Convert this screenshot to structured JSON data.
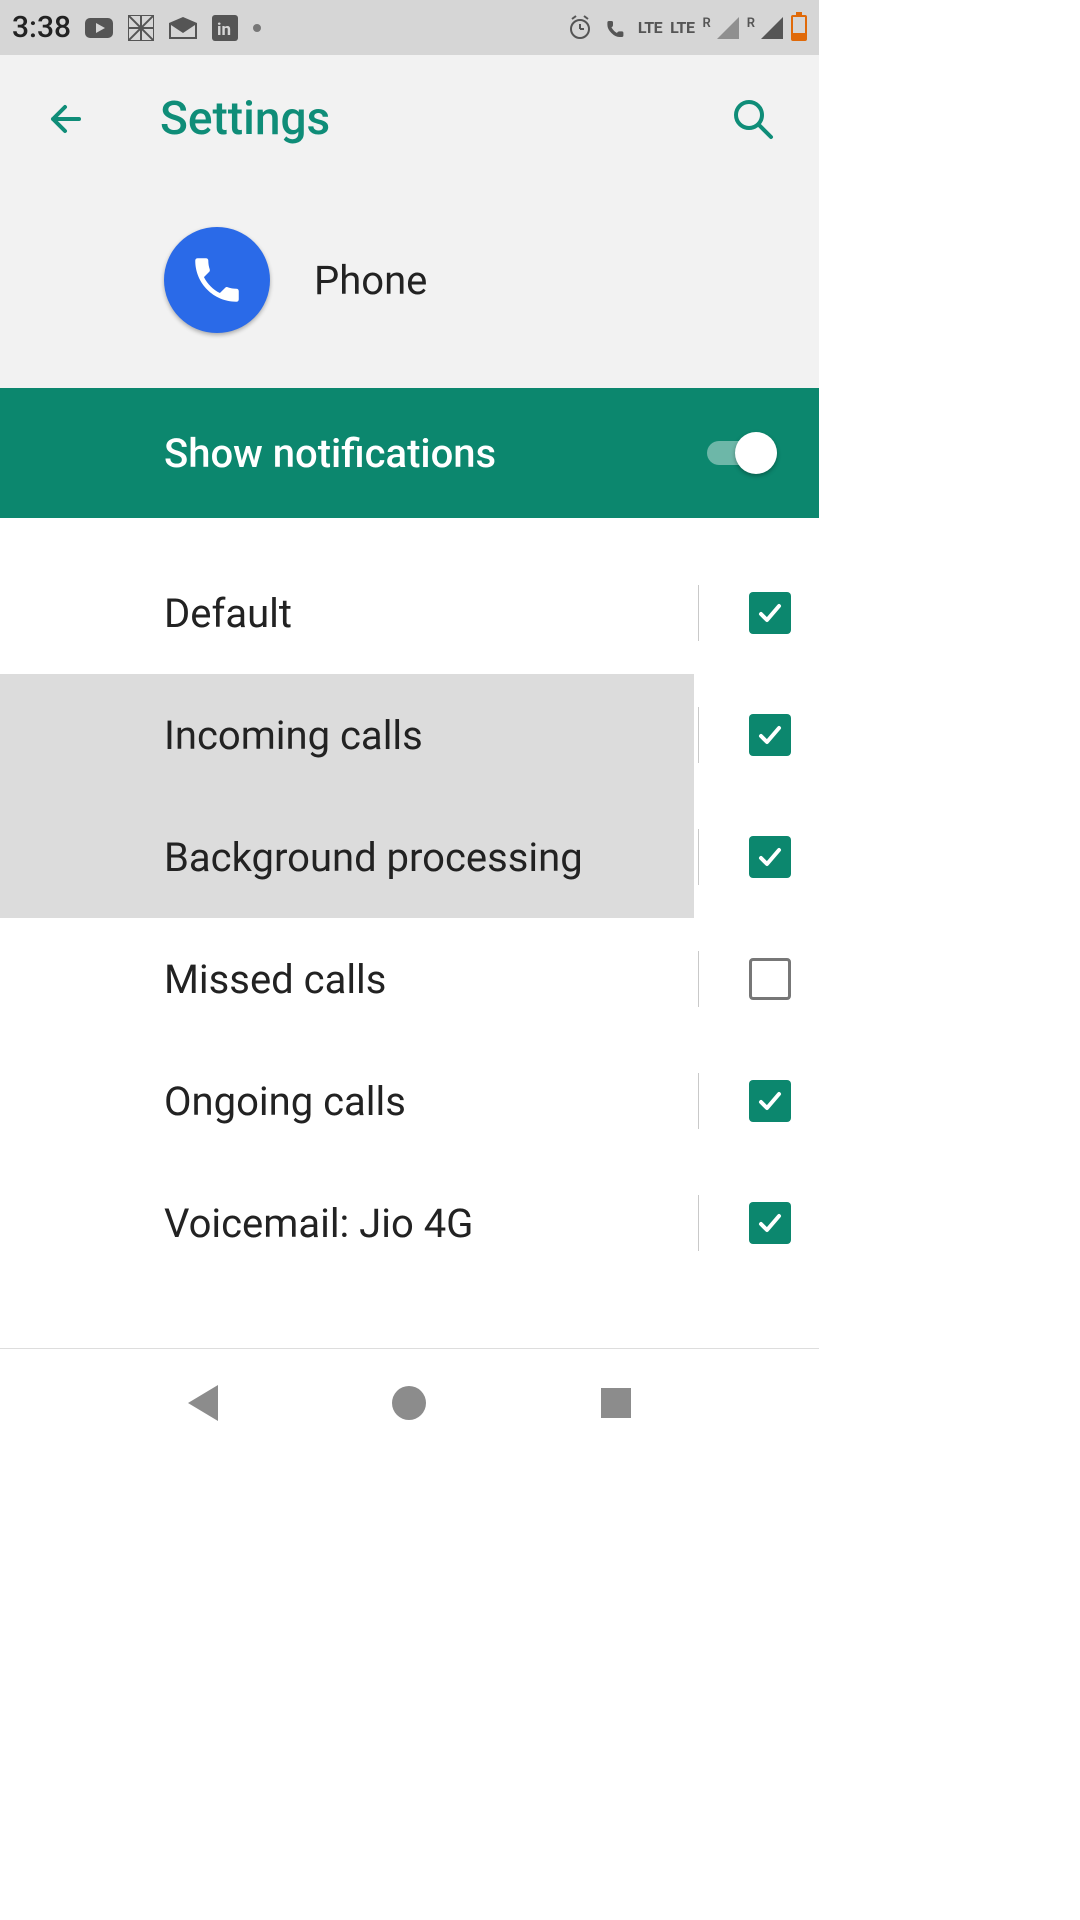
{
  "status": {
    "time": "3:38",
    "lte1": "LTE",
    "lte2": "LTE",
    "r": "R"
  },
  "appbar": {
    "title": "Settings"
  },
  "app": {
    "name": "Phone"
  },
  "toggle": {
    "label": "Show notifications",
    "on": true
  },
  "channels": [
    {
      "label": "Default",
      "checked": true,
      "highlighted": false
    },
    {
      "label": "Incoming calls",
      "checked": true,
      "highlighted": true
    },
    {
      "label": "Background processing",
      "checked": true,
      "highlighted": true
    },
    {
      "label": "Missed calls",
      "checked": false,
      "highlighted": false
    },
    {
      "label": "Ongoing calls",
      "checked": true,
      "highlighted": false
    },
    {
      "label": "Voicemail: Jio 4G",
      "checked": true,
      "highlighted": false
    }
  ],
  "colors": {
    "accent": "#0c876e",
    "title": "#0f8d78",
    "appicon": "#2a6ae8"
  }
}
